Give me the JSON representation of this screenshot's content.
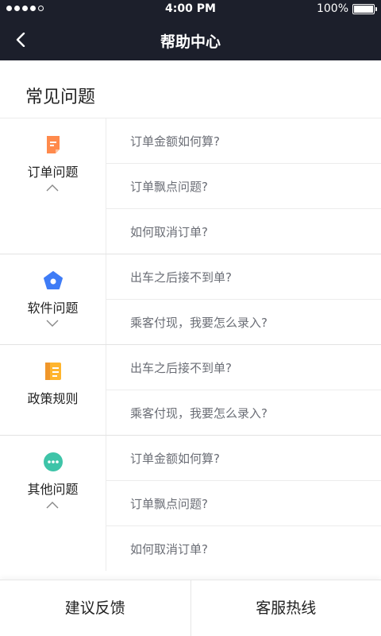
{
  "status_bar": {
    "time": "4:00 PM",
    "battery": "100%",
    "battery_level": 1.0,
    "signal_bars_filled": 4,
    "signal_bars_total": 5
  },
  "nav": {
    "title": "帮助中心",
    "back_icon": "chevron-left-icon"
  },
  "section_title": "常见问题",
  "categories": [
    {
      "label": "订单问题",
      "icon": "document-icon",
      "color": "#ff8a4c",
      "expanded": true,
      "questions": [
        "订单金额如何算?",
        "订单飘点问题?",
        "如何取消订单?"
      ]
    },
    {
      "label": "软件问题",
      "icon": "pentagon-icon",
      "color": "#3f7cf6",
      "expanded": false,
      "questions": [
        "出车之后接不到单?",
        "乘客付现，我要怎么录入?"
      ]
    },
    {
      "label": "政策规则",
      "icon": "notebook-icon",
      "color": "#ffb52e",
      "expanded": null,
      "questions": [
        "出车之后接不到单?",
        "乘客付现，我要怎么录入?"
      ]
    },
    {
      "label": "其他问题",
      "icon": "chat-bubble-icon",
      "color": "#3ec4a8",
      "expanded": true,
      "questions": [
        "订单金额如何算?",
        "订单飘点问题?",
        "如何取消订单?"
      ]
    }
  ],
  "bottom": {
    "feedback": "建议反馈",
    "hotline": "客服热线"
  }
}
